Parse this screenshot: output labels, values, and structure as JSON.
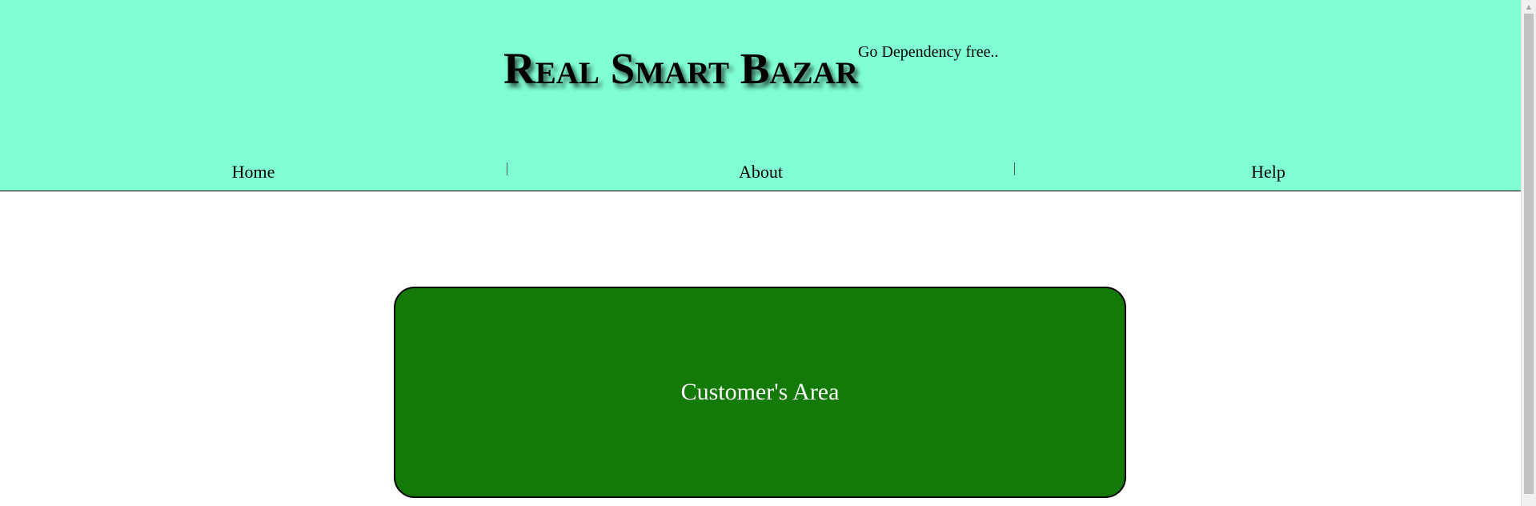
{
  "header": {
    "title": "Real Smart Bazar",
    "tagline": "Go Dependency free..",
    "background": "#80ffd6"
  },
  "nav": {
    "items": [
      {
        "label": "Home"
      },
      {
        "label": "About"
      },
      {
        "label": "Help"
      }
    ]
  },
  "main": {
    "customer_area_label": "Customer's Area",
    "card_color": "#137a07"
  },
  "scrollbar": {
    "up_arrow_icon": "triangle-up"
  }
}
